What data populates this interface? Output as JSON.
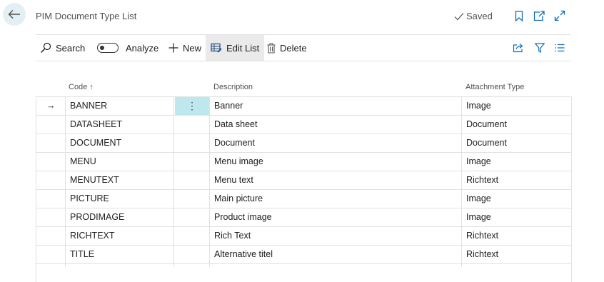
{
  "header": {
    "title": "PIM Document Type List",
    "saved_label": "Saved"
  },
  "toolbar": {
    "search_label": "Search",
    "analyze_label": "Analyze",
    "new_label": "New",
    "edit_list_label": "Edit List",
    "delete_label": "Delete"
  },
  "columns": {
    "code": "Code",
    "code_sort": "↑",
    "description": "Description",
    "attachment_type": "Attachment Type"
  },
  "rows": [
    {
      "code": "BANNER",
      "description": "Banner",
      "attachment_type": "Image"
    },
    {
      "code": "DATASHEET",
      "description": "Data sheet",
      "attachment_type": "Document"
    },
    {
      "code": "DOCUMENT",
      "description": "Document",
      "attachment_type": "Document"
    },
    {
      "code": "MENU",
      "description": "Menu image",
      "attachment_type": "Image"
    },
    {
      "code": "MENUTEXT",
      "description": "Menu text",
      "attachment_type": "Richtext"
    },
    {
      "code": "PICTURE",
      "description": "Main picture",
      "attachment_type": "Image"
    },
    {
      "code": "PRODIMAGE",
      "description": "Product image",
      "attachment_type": "Image"
    },
    {
      "code": "RICHTEXT",
      "description": "Rich Text",
      "attachment_type": "Richtext"
    },
    {
      "code": "TITLE",
      "description": "Alternative titel",
      "attachment_type": "Richtext"
    }
  ],
  "selection": {
    "row_indicator": "→",
    "menu_glyph": "⋮"
  },
  "colors": {
    "accent": "#00827a",
    "icon_blue": "#0f6cbd",
    "selected_cell": "#bfe7ee"
  },
  "icons": [
    "back-arrow-icon",
    "checkmark-icon",
    "bookmark-icon",
    "open-new-window-icon",
    "expand-icon",
    "search-icon",
    "plus-icon",
    "edit-list-icon",
    "trash-icon",
    "share-icon",
    "filter-icon",
    "list-icon"
  ]
}
